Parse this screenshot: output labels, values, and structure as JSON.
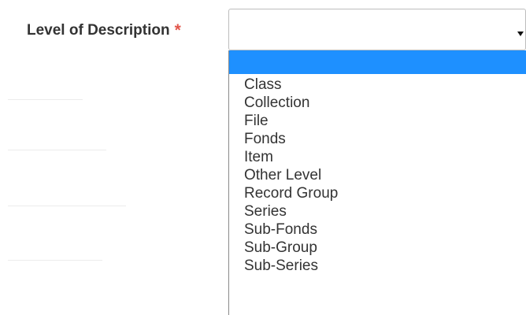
{
  "field": {
    "label": "Level of Description",
    "required_mark": "*"
  },
  "select": {
    "selected_value": "",
    "arrow_icon": "caret-down-icon",
    "options": [
      "",
      "Class",
      "Collection",
      "File",
      "Fonds",
      "Item",
      "Other Level",
      "Record Group",
      "Series",
      "Sub-Fonds",
      "Sub-Group",
      "Sub-Series"
    ]
  },
  "colors": {
    "label_text": "#333333",
    "required": "#e2564b",
    "highlight": "#1e90ff",
    "option_text": "#333333"
  }
}
